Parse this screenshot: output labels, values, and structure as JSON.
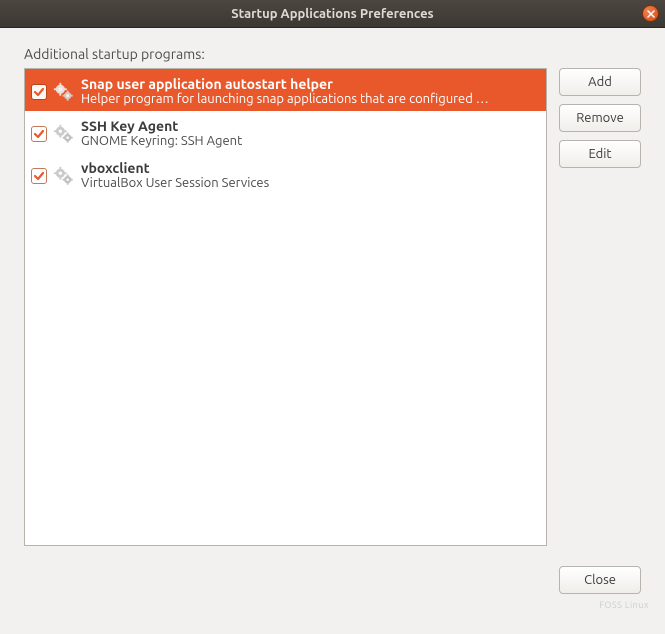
{
  "window": {
    "title": "Startup Applications Preferences"
  },
  "section_label": "Additional startup programs:",
  "items": [
    {
      "checked": true,
      "selected": true,
      "title": "Snap user application autostart helper",
      "desc": "Helper program for launching snap applications that are configured …"
    },
    {
      "checked": true,
      "selected": false,
      "title": "SSH Key Agent",
      "desc": "GNOME Keyring: SSH Agent"
    },
    {
      "checked": true,
      "selected": false,
      "title": "vboxclient",
      "desc": "VirtualBox User Session Services"
    }
  ],
  "buttons": {
    "add": "Add",
    "remove": "Remove",
    "edit": "Edit",
    "close": "Close"
  },
  "watermark": "FOSS Linux"
}
